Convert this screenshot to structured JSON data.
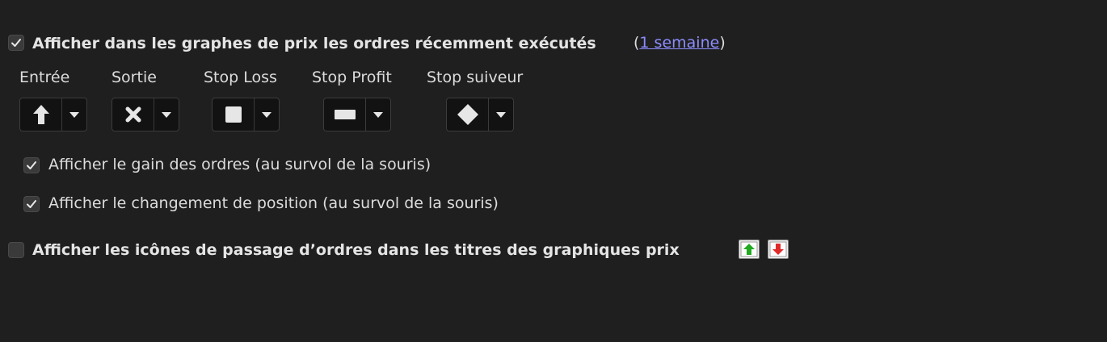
{
  "recent_orders": {
    "checked": true,
    "label": "Afficher dans les graphes de prix les ordres récemment exécutés",
    "paren_open": "(",
    "period_link": "1 semaine",
    "paren_close": ")"
  },
  "markers": [
    {
      "label": "Entrée",
      "icon": "arrow-up-icon"
    },
    {
      "label": "Sortie",
      "icon": "x-mark-icon"
    },
    {
      "label": "Stop Loss",
      "icon": "square-icon"
    },
    {
      "label": "Stop Profit",
      "icon": "bar-icon"
    },
    {
      "label": "Stop suiveur",
      "icon": "diamond-icon"
    }
  ],
  "show_gain": {
    "checked": true,
    "label": "Afficher le gain des ordres (au survol de la souris)"
  },
  "show_position_change": {
    "checked": true,
    "label": "Afficher le changement de position (au survol de la souris)"
  },
  "order_icons_in_titles": {
    "checked": false,
    "label": "Afficher les icônes de passage d’ordres dans les titres des graphiques prix",
    "icons": [
      "buy-order-icon",
      "sell-order-icon"
    ]
  },
  "colors": {
    "background": "#1f1f1f",
    "link": "#8c8cff",
    "buy_green": "#1faa1f",
    "sell_red": "#e02a2a"
  }
}
